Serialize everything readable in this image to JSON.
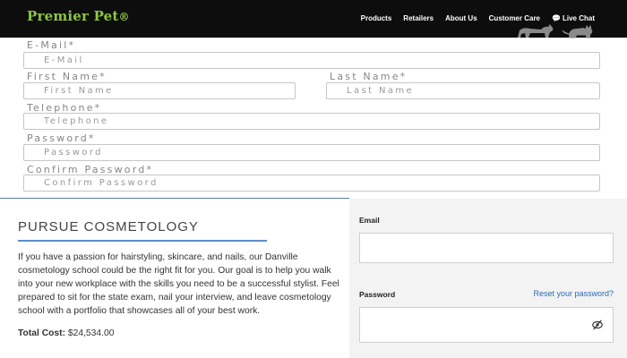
{
  "header": {
    "brand": "Premier Pet",
    "brand_mark": "®",
    "nav": [
      "Products",
      "Retailers",
      "About Us",
      "Customer Care"
    ],
    "chat_label": "Live Chat"
  },
  "register_form": {
    "email_label": "E-Mail*",
    "email_placeholder": "E-Mail",
    "first_name_label": "First Name*",
    "first_name_placeholder": "First Name",
    "last_name_label": "Last Name*",
    "last_name_placeholder": "Last Name",
    "telephone_label": "Telephone*",
    "telephone_placeholder": "Telephone",
    "password_label": "Password*",
    "password_placeholder": "Password",
    "confirm_label": "Confirm Password*",
    "confirm_placeholder": "Confirm Password"
  },
  "article": {
    "title": "PURSUE COSMETOLOGY",
    "body": "If you have a passion for hairstyling, skincare, and nails, our Danville cosmetology school could be the right fit for you. Our goal is to help you walk into your new workplace with the skills you need to be a successful stylist. Feel prepared to sit for the state exam, nail your interview, and leave cosmetology school with a portfolio that showcases all of your best work.",
    "cost_label": "Total Cost:",
    "cost_value": "$24,534.00"
  },
  "login": {
    "email_label": "Email",
    "password_label": "Password",
    "reset_link": "Reset your password?"
  },
  "colors": {
    "brand_green": "#8cc63f",
    "link_blue": "#2d6ab0",
    "nav_bg": "#0d0d0d"
  }
}
